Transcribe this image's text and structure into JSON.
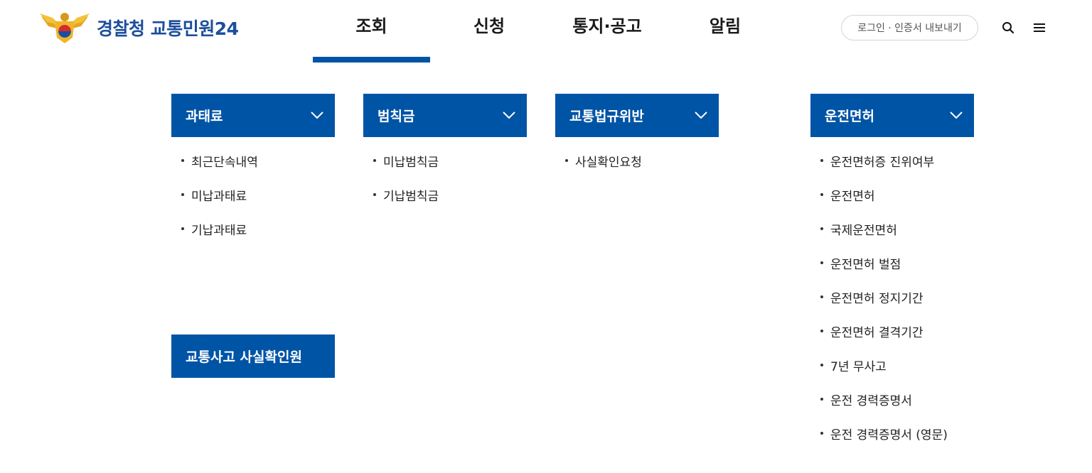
{
  "header": {
    "logo_text": "경찰청 교통민원24",
    "nav": [
      "조회",
      "신청",
      "통지·공고",
      "알림"
    ],
    "active_nav": "조회",
    "login_label": "로그인 · 인증서 내보내기"
  },
  "menu": {
    "fine": {
      "title": "과태료",
      "items": [
        "최근단속내역",
        "미납과태료",
        "기납과태료"
      ]
    },
    "penalty": {
      "title": "범칙금",
      "items": [
        "미납범칙금",
        "기납범칙금"
      ]
    },
    "violation": {
      "title": "교통법규위반",
      "items": [
        "사실확인요청"
      ]
    },
    "license": {
      "title": "운전면허",
      "items": [
        "운전면허증 진위여부",
        "운전면허",
        "국제운전면허",
        "운전면허 벌점",
        "운전면허 정지기간",
        "운전면허 결격기간",
        "7년 무사고",
        "운전 경력증명서",
        "운전 경력증명서 (영문)"
      ]
    },
    "accident": {
      "title": "교통사고 사실확인원"
    }
  },
  "colors": {
    "accent": "#0054a6",
    "logo": "#1d4e9c"
  },
  "icons": [
    "police-emblem-icon",
    "search-icon",
    "hamburger-menu-icon",
    "chevron-down-icon"
  ]
}
